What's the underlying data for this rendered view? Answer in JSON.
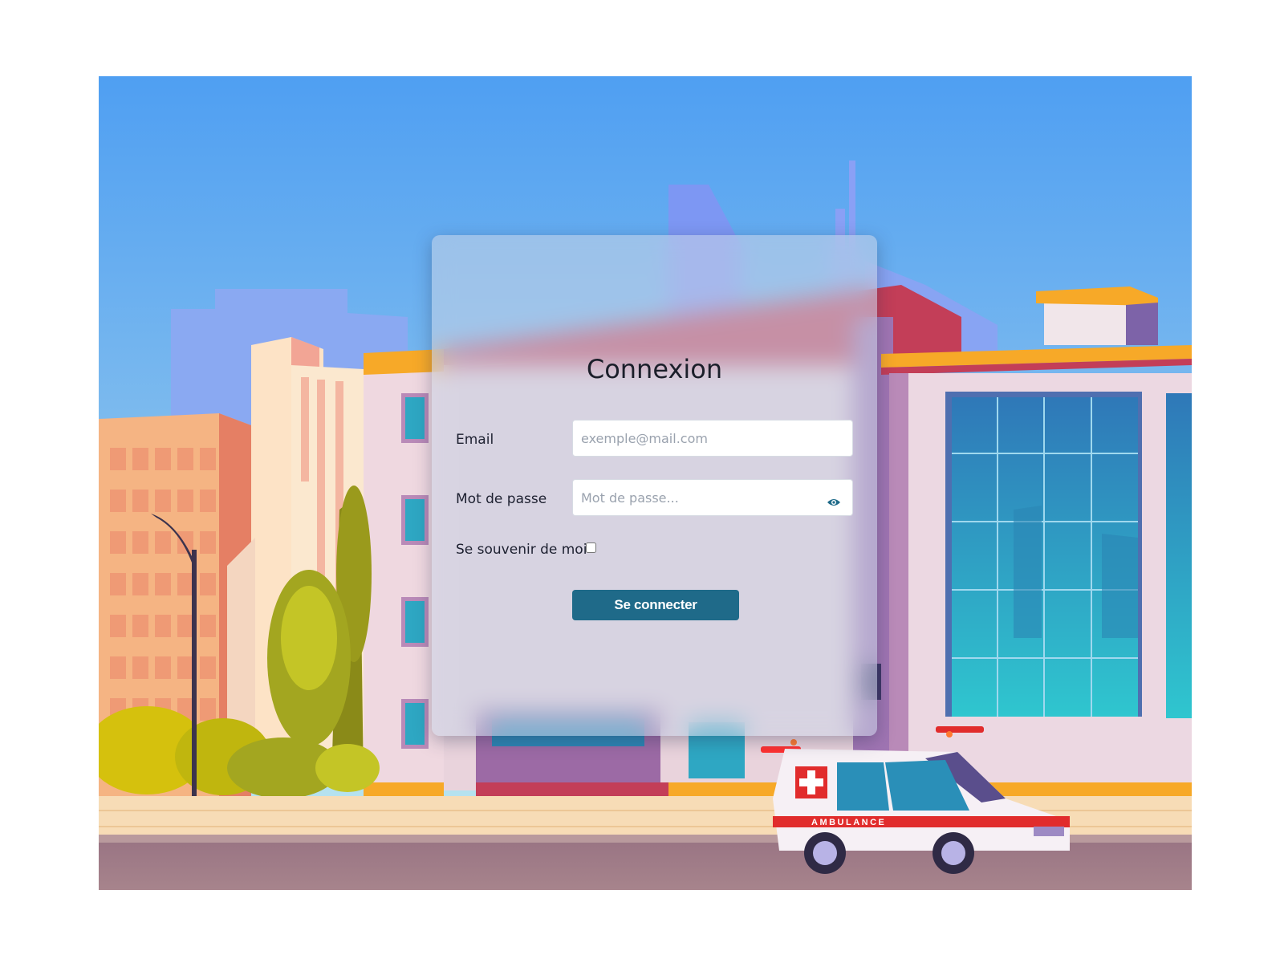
{
  "login": {
    "title": "Connexion",
    "email_label": "Email",
    "email_placeholder": "exemple@mail.com",
    "password_label": "Mot de passe",
    "password_placeholder": "Mot de passe...",
    "remember_label": "Se souvenir de moi",
    "submit_label": "Se connecter"
  },
  "background": {
    "vehicle_text": "AMBULANCE"
  },
  "colors": {
    "button": "#1f6a89",
    "eye_icon": "#1f6a89",
    "sky_top": "#4f9ff2",
    "sky_bottom": "#b6e4ee"
  }
}
